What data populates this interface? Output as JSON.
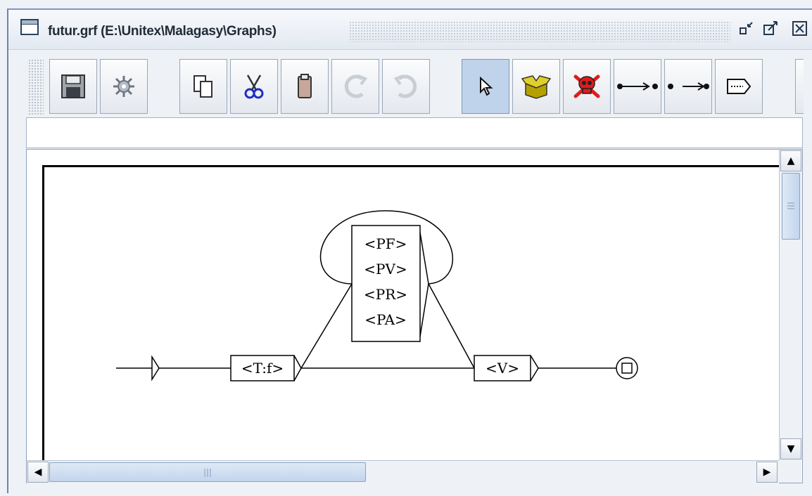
{
  "window": {
    "title": "futur.grf (E:\\Unitex\\Malagasy\\Graphs)",
    "controls": {
      "minimize": "↙",
      "maximize": "↗",
      "close": "✕"
    }
  },
  "toolbar": {
    "buttons": [
      {
        "name": "save",
        "icon": "floppy-disk-icon"
      },
      {
        "name": "compile",
        "icon": "gear-icon"
      },
      {
        "name": "copy",
        "icon": "copy-icon"
      },
      {
        "name": "cut",
        "icon": "scissors-icon"
      },
      {
        "name": "paste",
        "icon": "clipboard-icon"
      },
      {
        "name": "redo",
        "icon": "redo-icon",
        "enabled": false
      },
      {
        "name": "undo",
        "icon": "undo-icon",
        "enabled": false
      },
      {
        "name": "select",
        "icon": "cursor-arrow-icon",
        "selected": true
      },
      {
        "name": "open-subgraph",
        "icon": "open-box-icon"
      },
      {
        "name": "delete",
        "icon": "skull-crossbones-icon"
      },
      {
        "name": "link-boxes",
        "icon": "link-forward-icon"
      },
      {
        "name": "reverse-link",
        "icon": "link-backward-icon"
      },
      {
        "name": "edit-box",
        "icon": "edit-box-icon"
      }
    ]
  },
  "box_text_field": {
    "value": ""
  },
  "graph": {
    "boxes": {
      "tf": "<T:f>",
      "v": "<V>",
      "multi": [
        "<PF>",
        "<PV>",
        "<PR>",
        "<PA>"
      ]
    }
  },
  "colors": {
    "toolbar_selected": "#bfd3ea",
    "box_icon": "#b6a000",
    "skull": "#e01b1b",
    "scissors": "#1f2fbf"
  }
}
